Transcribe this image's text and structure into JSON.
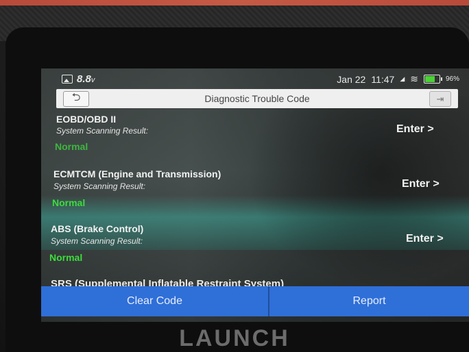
{
  "brand": "LAUNCH",
  "status_bar": {
    "voltage": "8.8",
    "voltage_unit": "v",
    "date": "Jan 22",
    "time": "11:47",
    "battery": "96%"
  },
  "header": {
    "title": "Diagnostic Trouble Code"
  },
  "systems": [
    {
      "name": "EOBD/OBD II",
      "label": "System Scanning Result:",
      "status": "Normal",
      "action": "Enter >"
    },
    {
      "name": "ECMTCM (Engine and Transmission)",
      "label": "System Scanning Result:",
      "status": "Normal",
      "action": "Enter >"
    },
    {
      "name": "ABS (Brake Control)",
      "label": "System Scanning Result:",
      "status": "Normal",
      "action": "Enter >"
    },
    {
      "name": "SRS (Supplemental Inflatable Restraint System)"
    }
  ],
  "footer": {
    "clear_code": "Clear Code",
    "report": "Report"
  },
  "colors": {
    "status_normal": "#3ddc3d",
    "footer_bar": "#2f6fd8",
    "header_bar": "#efefef"
  },
  "icons": [
    "image-icon",
    "wifi-icon",
    "battery-icon",
    "back-arrow-icon",
    "exit-icon"
  ]
}
